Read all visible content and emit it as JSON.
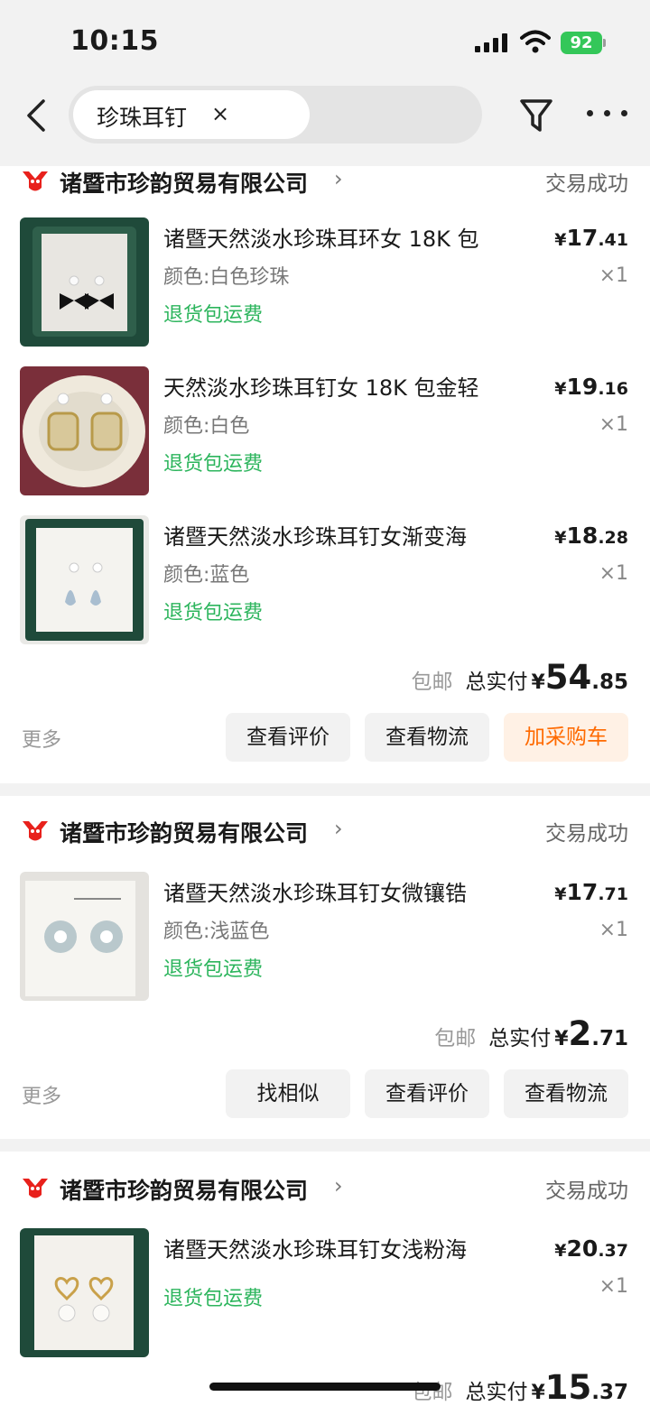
{
  "status_bar": {
    "time": "10:15",
    "battery": "92"
  },
  "header": {
    "search_tag": "珍珠耳钉",
    "close_symbol": "×"
  },
  "colors": {
    "green_tag": "#2db55d",
    "accent_orange": "#ff6a00",
    "store_logo_red": "#e8211c"
  },
  "orders": [
    {
      "store_name": "诸暨市珍韵贸易有限公司",
      "status": "交易成功",
      "items": [
        {
          "title": "诸暨天然淡水珍珠耳环女 18K 包",
          "spec": "颜色:白色珍珠",
          "tag": "退货包运费",
          "price_currency": "¥",
          "price_int": "17",
          "price_dec": ".41",
          "qty": "×1"
        },
        {
          "title": "天然淡水珍珠耳钉女 18K 包金轻",
          "spec": "颜色:白色",
          "tag": "退货包运费",
          "price_currency": "¥",
          "price_int": "19",
          "price_dec": ".16",
          "qty": "×1"
        },
        {
          "title": "诸暨天然淡水珍珠耳钉女渐变海",
          "spec": "颜色:蓝色",
          "tag": "退货包运费",
          "price_currency": "¥",
          "price_int": "18",
          "price_dec": ".28",
          "qty": "×1"
        }
      ],
      "shipping": "包邮",
      "total_label": "总实付",
      "total_currency": "¥",
      "total_int": "54",
      "total_dec": ".85",
      "more_label": "更多",
      "actions": [
        "查看评价",
        "查看物流",
        "加采购车"
      ]
    },
    {
      "store_name": "诸暨市珍韵贸易有限公司",
      "status": "交易成功",
      "items": [
        {
          "title": "诸暨天然淡水珍珠耳钉女微镶锆",
          "spec": "颜色:浅蓝色",
          "tag": "退货包运费",
          "price_currency": "¥",
          "price_int": "17",
          "price_dec": ".71",
          "qty": "×1"
        }
      ],
      "shipping": "包邮",
      "total_label": "总实付",
      "total_currency": "¥",
      "total_int": "2",
      "total_dec": ".71",
      "more_label": "更多",
      "actions": [
        "找相似",
        "查看评价",
        "查看物流"
      ]
    },
    {
      "store_name": "诸暨市珍韵贸易有限公司",
      "status": "交易成功",
      "items": [
        {
          "title": "诸暨天然淡水珍珠耳钉女浅粉海",
          "tag": "退货包运费",
          "price_currency": "¥",
          "price_int": "20",
          "price_dec": ".37",
          "qty": "×1"
        }
      ],
      "shipping": "包邮",
      "total_label": "总实付",
      "total_currency": "¥",
      "total_int": "15",
      "total_dec": ".37"
    }
  ]
}
